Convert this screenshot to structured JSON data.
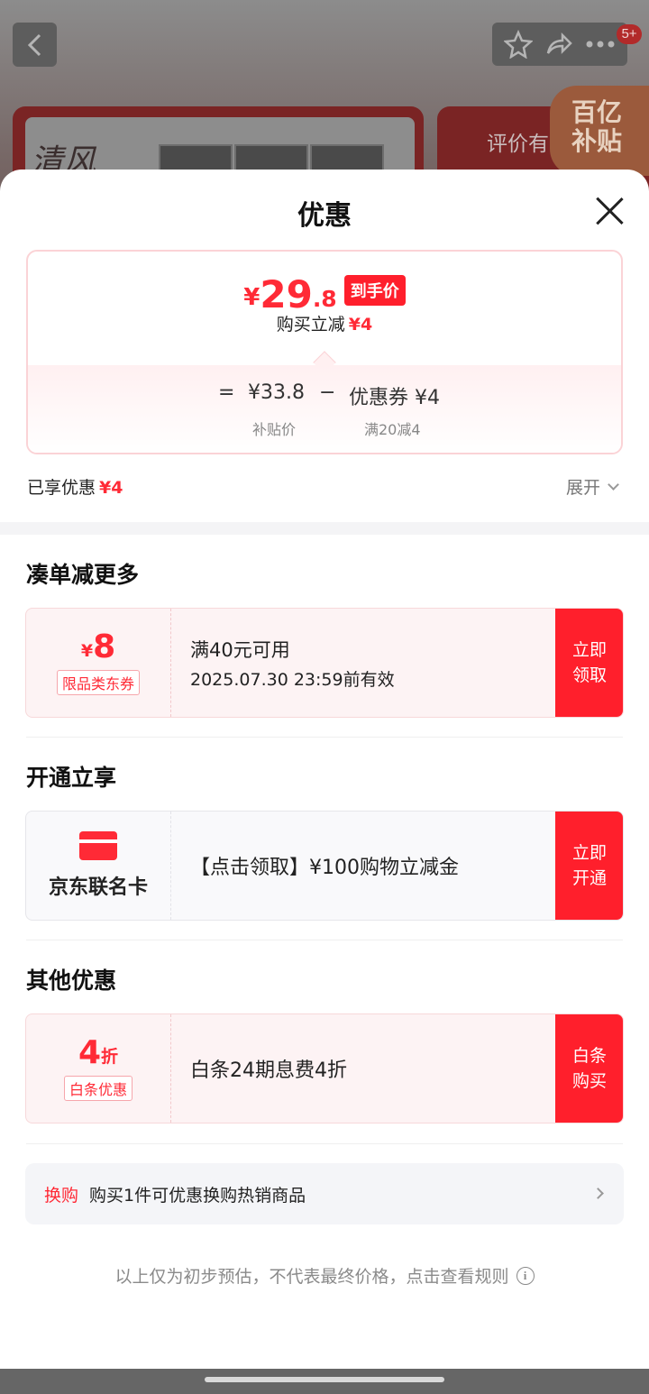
{
  "background": {
    "badge": "5+",
    "brand_logo_text": "清风",
    "card2_text": "评价有",
    "subsidy_line1": "百亿",
    "subsidy_line2": "补贴"
  },
  "sheet": {
    "title": "优惠",
    "price": {
      "currency": "¥",
      "integer": "29",
      "decimal": ".8",
      "tag": "到手价",
      "reduce_label": "购买立减",
      "reduce_amount": "¥4"
    },
    "formula": {
      "equals": "=",
      "subsidy_price": "¥33.8",
      "minus": "−",
      "coupon": "优惠券 ¥4",
      "subsidy_label": "补贴价",
      "coupon_rule": "满20减4"
    },
    "enjoyed_label": "已享优惠",
    "enjoyed_amount": "¥4",
    "expand_label": "展开"
  },
  "sections": {
    "more": {
      "title": "凑单减更多",
      "coupon": {
        "currency": "¥",
        "value": "8",
        "tag": "限品类东券",
        "condition": "满40元可用",
        "expiry": "2025.07.30 23:59前有效",
        "button": "立即领取"
      }
    },
    "open": {
      "title": "开通立享",
      "card_label": "京东联名卡",
      "text": "【点击领取】¥100购物立减金",
      "button": "立即开通"
    },
    "other": {
      "title": "其他优惠",
      "value": "4",
      "unit": "折",
      "tag": "白条优惠",
      "text": "白条24期息费4折",
      "button": "白条购买"
    }
  },
  "swap": {
    "tag": "换购",
    "text": "购买1件可优惠换购热销商品"
  },
  "disclaimer": "以上仅为初步预估，不代表最终价格，点击查看规则"
}
